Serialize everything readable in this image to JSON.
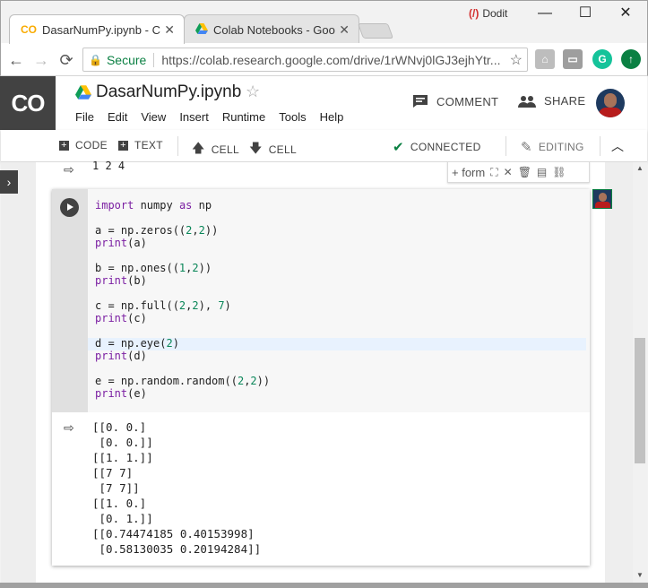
{
  "browser": {
    "tabs": [
      {
        "label": "DasarNumPy.ipynb - Cola",
        "icon": "colab-icon"
      },
      {
        "label": "Colab Notebooks - Goog",
        "icon": "drive-icon"
      }
    ],
    "dodit_label": "Dodit",
    "window_controls": {
      "minimize": "—",
      "maximize": "☐",
      "close": "✕"
    },
    "nav": {
      "back": "←",
      "forward": "→",
      "reload": "⟳"
    },
    "secure_label": "Secure",
    "url": "https://colab.research.google.com/drive/1rWNvj0lGJ3ejhYtr...",
    "bookmark_star": "☆"
  },
  "colab": {
    "logo": "CO",
    "notebook_title": "DasarNumPy.ipynb",
    "star": "☆",
    "menu": [
      "File",
      "Edit",
      "View",
      "Insert",
      "Runtime",
      "Tools",
      "Help"
    ],
    "comment_label": "COMMENT",
    "share_label": "SHARE",
    "toolbar": {
      "code_label": "CODE",
      "text_label": "TEXT",
      "cell_up_label": "CELL",
      "cell_down_label": "CELL",
      "connected_label": "CONNECTED",
      "editing_label": "EDITING"
    }
  },
  "prev_output": "1 2 4",
  "cell_toolbar": {
    "form_label": "+ form"
  },
  "code_lines": [
    {
      "parts": [
        {
          "t": "import",
          "c": "kw"
        },
        {
          "t": " numpy ",
          "c": ""
        },
        {
          "t": "as",
          "c": "kw"
        },
        {
          "t": " np",
          "c": ""
        }
      ]
    },
    {
      "parts": []
    },
    {
      "parts": [
        {
          "t": "a = np.zeros((",
          "c": ""
        },
        {
          "t": "2",
          "c": "num"
        },
        {
          "t": ",",
          "c": ""
        },
        {
          "t": "2",
          "c": "num"
        },
        {
          "t": "))",
          "c": ""
        }
      ]
    },
    {
      "parts": [
        {
          "t": "print",
          "c": "kw"
        },
        {
          "t": "(a)",
          "c": ""
        }
      ]
    },
    {
      "parts": []
    },
    {
      "parts": [
        {
          "t": "b = np.ones((",
          "c": ""
        },
        {
          "t": "1",
          "c": "num"
        },
        {
          "t": ",",
          "c": ""
        },
        {
          "t": "2",
          "c": "num"
        },
        {
          "t": "))",
          "c": ""
        }
      ]
    },
    {
      "parts": [
        {
          "t": "print",
          "c": "kw"
        },
        {
          "t": "(b)",
          "c": ""
        }
      ]
    },
    {
      "parts": []
    },
    {
      "parts": [
        {
          "t": "c = np.full((",
          "c": ""
        },
        {
          "t": "2",
          "c": "num"
        },
        {
          "t": ",",
          "c": ""
        },
        {
          "t": "2",
          "c": "num"
        },
        {
          "t": "), ",
          "c": ""
        },
        {
          "t": "7",
          "c": "num"
        },
        {
          "t": ")",
          "c": ""
        }
      ]
    },
    {
      "parts": [
        {
          "t": "print",
          "c": "kw"
        },
        {
          "t": "(c)",
          "c": ""
        }
      ]
    },
    {
      "parts": []
    },
    {
      "parts": [
        {
          "t": "d = np.eye(",
          "c": ""
        },
        {
          "t": "2",
          "c": "num"
        },
        {
          "t": ")",
          "c": ""
        }
      ]
    },
    {
      "parts": [
        {
          "t": "print",
          "c": "kw"
        },
        {
          "t": "(d)",
          "c": ""
        }
      ]
    },
    {
      "parts": []
    },
    {
      "parts": [
        {
          "t": "e = np.random.random((",
          "c": ""
        },
        {
          "t": "2",
          "c": "num"
        },
        {
          "t": ",",
          "c": ""
        },
        {
          "t": "2",
          "c": "num"
        },
        {
          "t": "))",
          "c": ""
        }
      ]
    },
    {
      "parts": [
        {
          "t": "print",
          "c": "kw"
        },
        {
          "t": "(e)",
          "c": ""
        }
      ]
    }
  ],
  "output_lines": [
    "[[0. 0.]",
    " [0. 0.]]",
    "[[1. 1.]]",
    "[[7 7]",
    " [7 7]]",
    "[[1. 0.]",
    " [0. 1.]]",
    "[[0.74474185 0.40153998]",
    " [0.58130035 0.20194284]]"
  ],
  "colors": {
    "accent_green": "#0b8043",
    "keyword": "#7b1fa2",
    "number": "#098658",
    "logo_bg": "#424242"
  }
}
